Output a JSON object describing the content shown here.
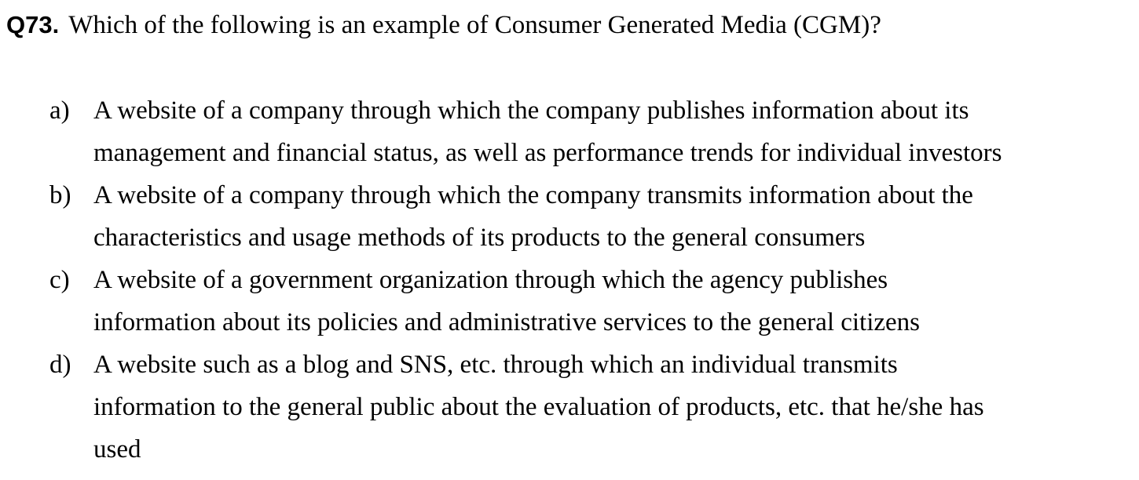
{
  "question": {
    "number": "Q73.",
    "text": "Which of the following is an example of Consumer Generated Media (CGM)?"
  },
  "options": [
    {
      "letter": "a)",
      "lines": [
        "A website of a company through which the company publishes information about its",
        "management and financial status, as well as performance trends for individual investors"
      ]
    },
    {
      "letter": "b)",
      "lines": [
        "A website of a company through which the company transmits information about the",
        "characteristics and usage methods of its products to the general consumers"
      ]
    },
    {
      "letter": "c)",
      "lines": [
        "A website of a government organization through which the agency publishes",
        "information about its policies and administrative services to the general citizens"
      ]
    },
    {
      "letter": "d)",
      "lines": [
        "A website such as a blog and SNS, etc. through which an individual transmits",
        "information to the general public about the evaluation of products, etc. that he/she has",
        "used"
      ]
    }
  ]
}
